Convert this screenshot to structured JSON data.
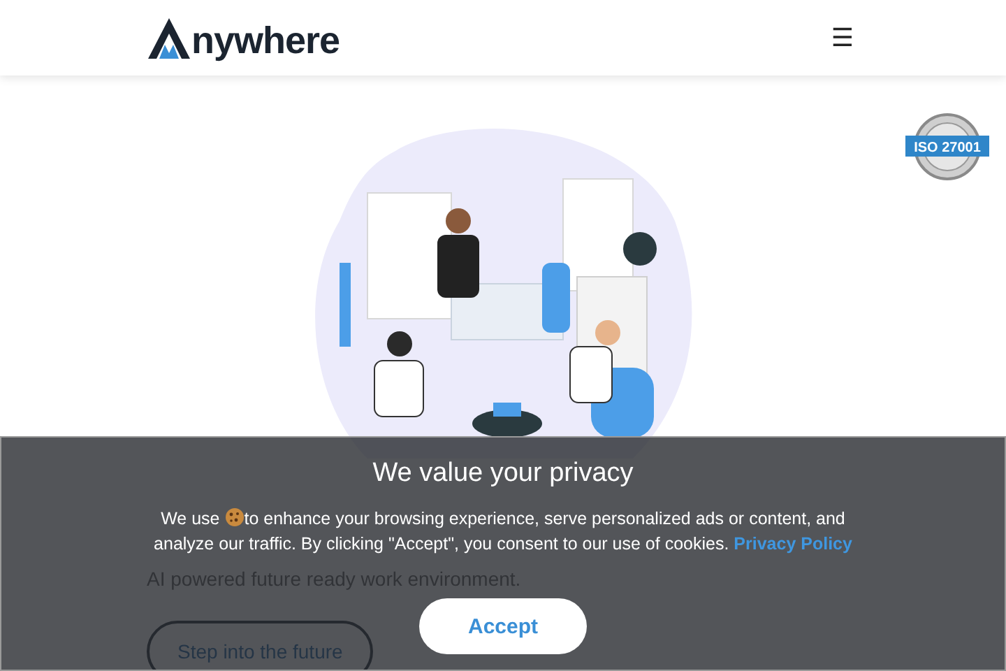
{
  "header": {
    "logo": {
      "text": "nywhere"
    },
    "menu_button": {
      "label": "☰"
    }
  },
  "badge": {
    "text": "ISO 27001"
  },
  "hero": {
    "subtitle": "AI powered future ready work environment.",
    "cta": "Step into the future"
  },
  "cookie_banner": {
    "title": "We value your privacy",
    "text_before": "We use",
    "text_after": "to enhance your browsing experience, serve personalized ads or content, and analyze our traffic. By clicking \"Accept\", you consent to our use of cookies.",
    "link": "Privacy Policy",
    "accept": "Accept"
  }
}
